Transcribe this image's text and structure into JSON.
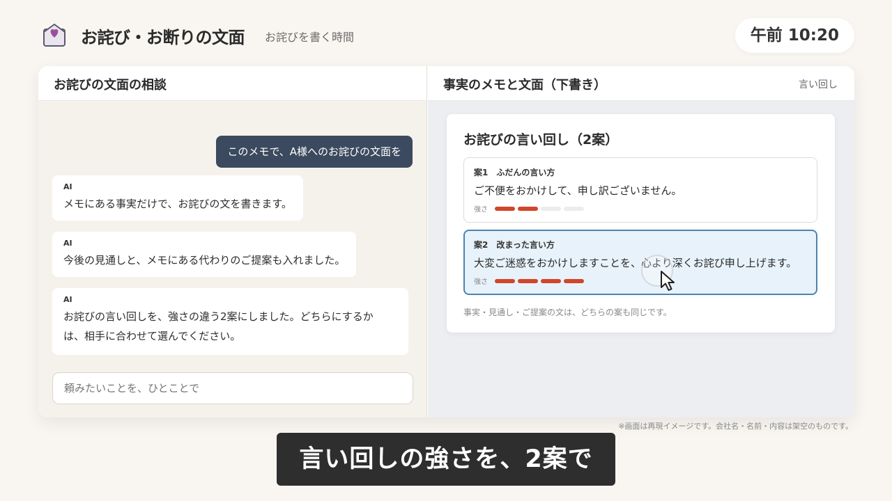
{
  "header": {
    "icon": "envelope-heart-icon",
    "title": "お詫び・お断りの文面",
    "subtitle": "お詫びを書く時間",
    "clock": "午前 10:20"
  },
  "left_pane": {
    "title": "お詫びの文面の相談",
    "messages": [
      {
        "role": "user",
        "text": "このメモで、A様へのお詫びの文面を"
      },
      {
        "role": "ai",
        "who": "AI",
        "lines": [
          "メモにある事実だけで、お詫びの文を書きます。"
        ]
      },
      {
        "role": "ai",
        "who": "AI",
        "lines": [
          "今後の見通しと、メモにある代わりのご提案も入れました。"
        ]
      },
      {
        "role": "ai",
        "who": "AI",
        "lines": [
          "お詫びの言い回しを、強さの違う2案にしました。どちらにするか",
          "は、相手に合わせて選んでください。"
        ]
      }
    ],
    "input_placeholder": "頼みたいことを、ひとことで"
  },
  "right_pane": {
    "title": "事実のメモと文面（下書き）",
    "link": "言い回し",
    "card": {
      "title": "お詫びの言い回し（2案）",
      "options": [
        {
          "label": "案1　ふだんの言い方",
          "text": "ご不便をおかけして、申し訳ございません。",
          "strength_label": "強さ",
          "strength": 2,
          "strength_max": 4,
          "selected": false
        },
        {
          "label": "案2　改まった言い方",
          "text": "大変ご迷惑をおかけしますことを、心より深くお詫び申し上げます。",
          "strength_label": "強さ",
          "strength": 4,
          "strength_max": 4,
          "selected": true
        }
      ],
      "note": "事実・見通し・ご提案の文は、どちらの案も同じです。"
    }
  },
  "colors": {
    "accent_dark": "#3b4a5e",
    "strength_on": "#d0462b",
    "selected_border": "#4a83b0",
    "selected_bg": "#e8f2fa"
  },
  "disclaimer": "※画面は再現イメージです。会社名・名前・内容は架空のものです。",
  "caption": "言い回しの強さを、2案で"
}
